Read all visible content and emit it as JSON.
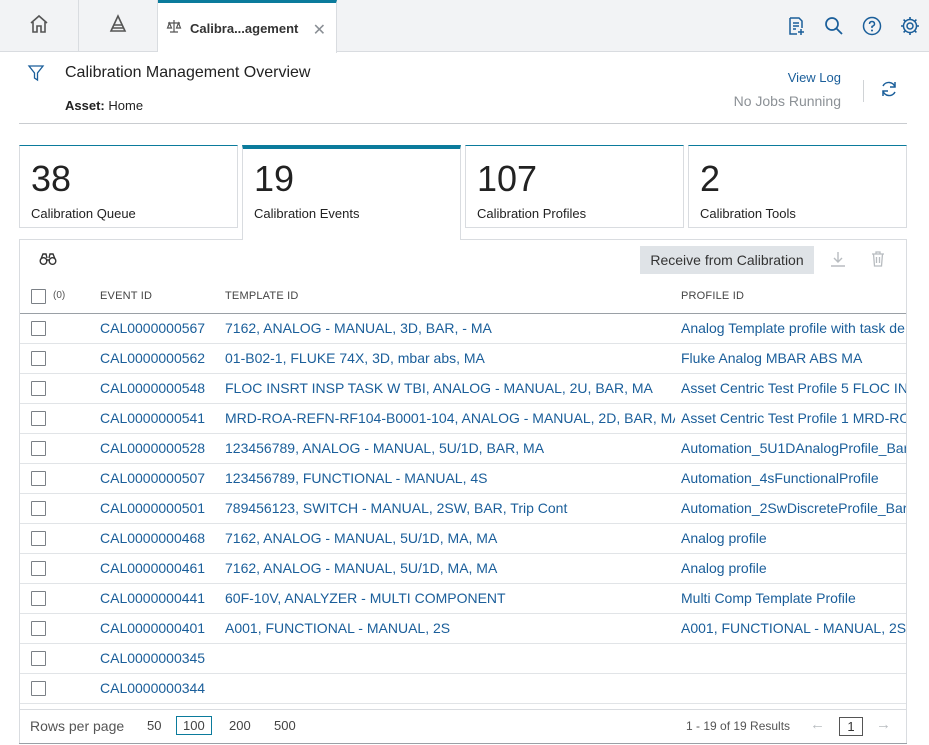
{
  "tabs": {
    "active_label": "Calibra...agement"
  },
  "header": {
    "title": "Calibration Management Overview",
    "asset_label": "Asset:",
    "asset_value": "Home",
    "view_log": "View Log",
    "jobs_status": "No Jobs Running"
  },
  "cards": [
    {
      "count": "38",
      "label": "Calibration Queue"
    },
    {
      "count": "19",
      "label": "Calibration Events"
    },
    {
      "count": "107",
      "label": "Calibration Profiles"
    },
    {
      "count": "2",
      "label": "Calibration Tools"
    }
  ],
  "toolbar": {
    "receive_label": "Receive from Calibration"
  },
  "table": {
    "selected_count": "(0)",
    "columns": [
      "EVENT ID",
      "TEMPLATE ID",
      "PROFILE ID"
    ],
    "rows": [
      {
        "event": "CAL0000000567",
        "template": "7162, ANALOG - MANUAL, 3D, BAR, - MA",
        "profile": "Analog Template profile with task de"
      },
      {
        "event": "CAL0000000562",
        "template": "01-B02-1, FLUKE 74X, 3D, mbar abs, MA",
        "profile": "Fluke Analog MBAR ABS MA"
      },
      {
        "event": "CAL0000000548",
        "template": "FLOC INSRT INSP TASK W TBI, ANALOG - MANUAL, 2U, BAR, MA",
        "profile": "Asset Centric Test Profile 5 FLOC INS"
      },
      {
        "event": "CAL0000000541",
        "template": "MRD-ROA-REFN-RF104-B0001-104, ANALOG - MANUAL, 2D, BAR, MA",
        "profile": "Asset Centric Test Profile 1 MRD-RO"
      },
      {
        "event": "CAL0000000528",
        "template": "123456789, ANALOG - MANUAL, 5U/1D, BAR, MA",
        "profile": "Automation_5U1DAnalogProfile_Bar"
      },
      {
        "event": "CAL0000000507",
        "template": "123456789, FUNCTIONAL - MANUAL, 4S",
        "profile": "Automation_4sFunctionalProfile"
      },
      {
        "event": "CAL0000000501",
        "template": "789456123, SWITCH - MANUAL, 2SW, BAR, Trip Cont",
        "profile": "Automation_2SwDiscreteProfile_Bar"
      },
      {
        "event": "CAL0000000468",
        "template": "7162, ANALOG - MANUAL, 5U/1D, MA, MA",
        "profile": "Analog profile"
      },
      {
        "event": "CAL0000000461",
        "template": "7162, ANALOG - MANUAL, 5U/1D, MA, MA",
        "profile": "Analog profile"
      },
      {
        "event": "CAL0000000441",
        "template": "60F-10V, ANALYZER - MULTI COMPONENT",
        "profile": "Multi Comp Template Profile"
      },
      {
        "event": "CAL0000000401",
        "template": "A001, FUNCTIONAL - MANUAL, 2S",
        "profile": "A001, FUNCTIONAL - MANUAL, 2S ~"
      },
      {
        "event": "CAL0000000345",
        "template": "",
        "profile": ""
      },
      {
        "event": "CAL0000000344",
        "template": "",
        "profile": ""
      }
    ]
  },
  "footer": {
    "rows_per_page_label": "Rows per page",
    "options": [
      "50",
      "100",
      "200",
      "500"
    ],
    "selected_option": "100",
    "results": "1 - 19 of 19 Results",
    "page": "1"
  },
  "colors": {
    "accent": "#0b7b9c",
    "link": "#1a5e9a"
  }
}
